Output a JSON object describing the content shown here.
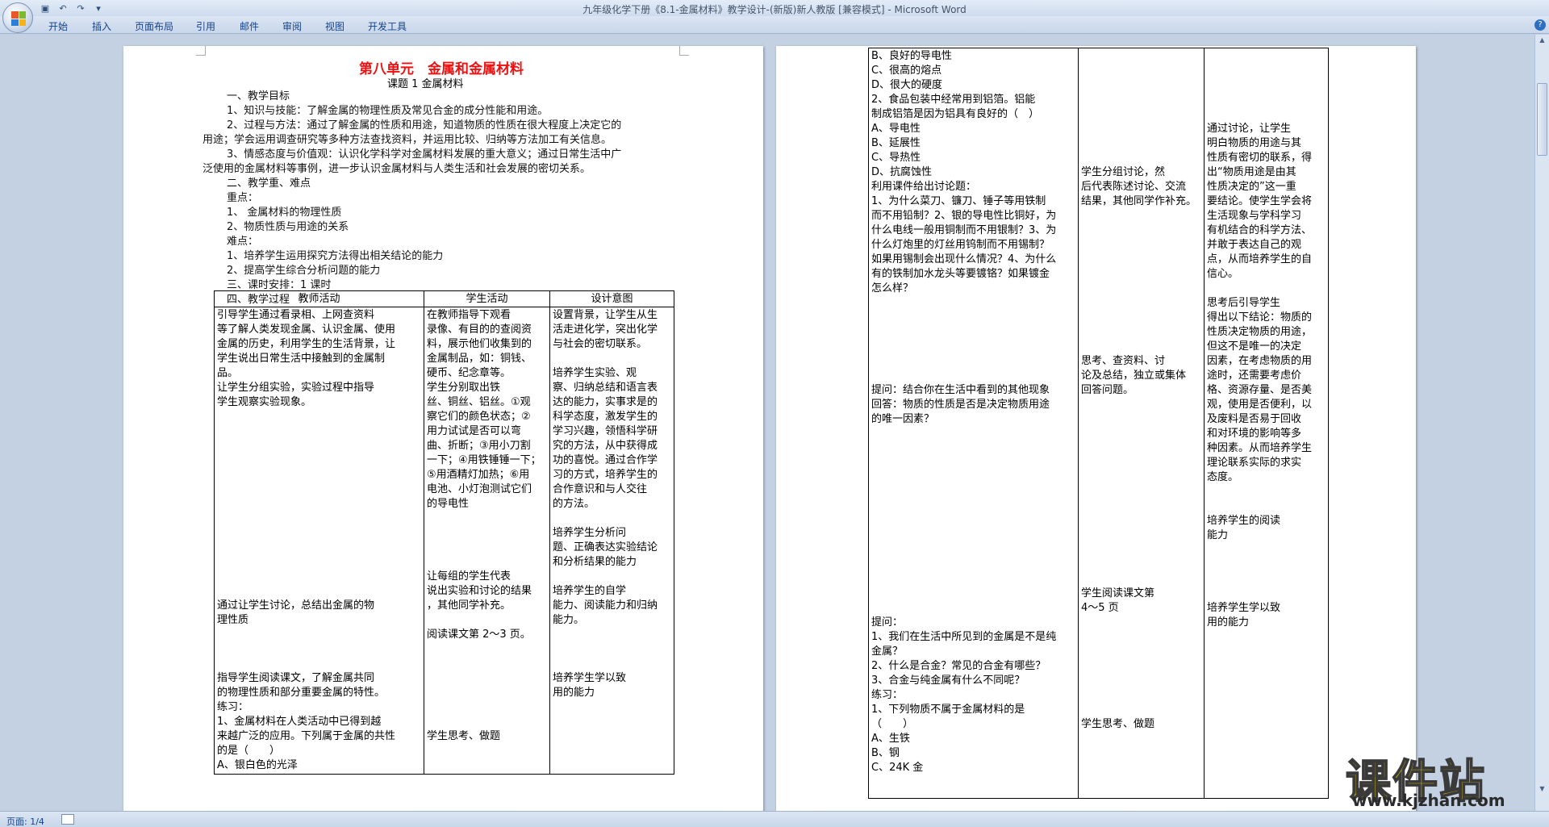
{
  "window": {
    "title": "九年级化学下册《8.1-金属材料》教学设计-(新版)新人教版 [兼容模式] - Microsoft Word",
    "ribbon_tabs": [
      "开始",
      "插入",
      "页面布局",
      "引用",
      "邮件",
      "审阅",
      "视图",
      "开发工具"
    ],
    "qat_icons": [
      "save-icon",
      "undo-icon",
      "redo-icon",
      "customize-icon"
    ],
    "help_label": "?"
  },
  "status": {
    "page": "页面: 1/4"
  },
  "watermark": {
    "text": "课件站",
    "url": "www.kjzhan.com"
  },
  "page1": {
    "title": "第八单元　金属和金属材料",
    "subtitle": "课题 1 金属材料",
    "lines": [
      "一、教学目标",
      "1、知识与技能：了解金属的物理性质及常见合金的成分性能和用途。",
      "2、过程与方法：通过了解金属的性质和用途，知道物质的性质在很大程度上决定它的",
      "用途；学会运用调查研究等多种方法查找资料，并运用比较、归纳等方法加工有关信息。",
      "3、情感态度与价值观：认识化学科学对金属材料发展的重大意义；通过日常生活中广",
      "泛使用的金属材料等事例，进一步认识金属材料与人类生活和社会发展的密切关系。",
      "二、教学重、难点",
      "重点：",
      "1、 金属材料的物理性质",
      "2、物质性质与用途的关系",
      "难点：",
      "1、培养学生运用探究方法得出相关结论的能力",
      "2、提高学生综合分析问题的能力",
      "三、课时安排：1 课时",
      "四、教学过程"
    ],
    "table_headers": [
      "教师活动",
      "学生活动",
      "设计意图"
    ],
    "col1": [
      "引导学生通过看录相、上网查资料",
      "等了解人类发现金属、认识金属、使用",
      "金属的历史，利用学生的生活背景，让",
      "学生说出日常生活中接触到的金属制",
      "品。",
      "让学生分组实验，实验过程中指导",
      "学生观察实验现象。",
      "",
      "",
      "",
      "",
      "",
      "",
      "",
      "",
      "",
      "",
      "",
      "",
      "",
      "通过让学生讨论，总结出金属的物",
      "理性质",
      "",
      "",
      "",
      "指导学生阅读课文，了解金属共同",
      "的物理性质和部分重要金属的特性。",
      "练习：",
      "1、金属材料在人类活动中已得到越",
      "来越广泛的应用。下列属于金属的共性",
      "的是（　　）",
      "A、银白色的光泽"
    ],
    "col2": [
      "在教师指导下观看",
      "录像、有目的的查阅资",
      "料，展示他们收集到的",
      "金属制品，如：铜钱、",
      "硬币、纪念章等。",
      "学生分别取出铁",
      "丝、铜丝、铝丝。①观",
      "察它们的颜色状态；②",
      "用力试试是否可以弯",
      "曲、折断；③用小刀割",
      "一下；④用铁锤锤一下；",
      "⑤用酒精灯加热；⑥用",
      "电池、小灯泡测试它们",
      "的导电性",
      "",
      "",
      "",
      "",
      "让每组的学生代表",
      "说出实验和讨论的结果",
      "，其他同学补充。",
      "",
      "阅读课文第 2～3 页。",
      "",
      "",
      "",
      "",
      "",
      "",
      "学生思考、做题"
    ],
    "col3": [
      "设置背景，让学生从生",
      "活走进化学，突出化学",
      "与社会的密切联系。",
      "",
      "培养学生实验、观",
      "察、归纳总结和语言表",
      "达的能力，实事求是的",
      "科学态度，激发学生的",
      "学习兴趣，领悟科学研",
      "究的方法，从中获得成",
      "功的喜悦。通过合作学",
      "习的方式，培养学生的",
      "合作意识和与人交往",
      "的方法。",
      "",
      "培养学生分析问",
      "题、正确表达实验结论",
      "和分析结果的能力",
      "",
      "培养学生的自学",
      "能力、阅读能力和归纳",
      "能力。",
      "",
      "",
      "",
      "培养学生学以致",
      "用的能力",
      "",
      "",
      "",
      ""
    ]
  },
  "page2": {
    "col1": [
      "B、良好的导电性",
      "C、很高的熔点",
      "D、很大的硬度",
      "2、食品包装中经常用到铝箔。铝能",
      "制成铝箔是因为铝具有良好的（　）",
      "A、导电性",
      "B、延展性",
      "C、导热性",
      "D、抗腐蚀性",
      "利用课件给出讨论题：",
      "1、为什么菜刀、镰刀、锤子等用铁制",
      "而不用铅制？2、银的导电性比铜好，为",
      "什么电线一般用铜制而不用银制？3、为",
      "什么灯炮里的灯丝用钨制而不用锡制？",
      "如果用锡制会出现什么情况？4、为什么",
      "有的铁制加水龙头等要镀铬？如果镀金",
      "怎么样？",
      "",
      "",
      "",
      "",
      "",
      "",
      "提问：结合你在生活中看到的其他现象",
      "回答：物质的性质是否是决定物质用途",
      "的唯一因素？",
      "",
      "",
      "",
      "",
      "",
      "",
      "",
      "",
      "",
      "",
      "",
      "",
      "",
      "提问：",
      "1、我们在生活中所见到的金属是不是纯",
      "金属？",
      "2、什么是合金？常见的合金有哪些？",
      "3、合金与纯金属有什么不同呢？",
      "练习：",
      "1、下列物质不属于金属材料的是",
      "（　　）",
      "A、生铁",
      "B、钢",
      "C、24K 金"
    ],
    "col2": [
      "",
      "",
      "",
      "",
      "",
      "",
      "",
      "",
      "学生分组讨论，然",
      "后代表陈述讨论、交流",
      "结果，其他同学作补充。",
      "",
      "",
      "",
      "",
      "",
      "",
      "",
      "",
      "",
      "",
      "思考、查资料、讨",
      "论及总结，独立或集体",
      "回答问题。",
      "",
      "",
      "",
      "",
      "",
      "",
      "",
      "",
      "",
      "",
      "",
      "",
      "",
      "学生阅读课文第",
      "4～5 页",
      "",
      "",
      "",
      "",
      "",
      "",
      "",
      "学生思考、做题"
    ],
    "col3": [
      "",
      "",
      "",
      "",
      "",
      "通过讨论，让学生",
      "明白物质的用途与其",
      "性质有密切的联系，得",
      "出“物质用途是由其",
      "性质决定的”这一重",
      "要结论。使学生学会将",
      "生活现象与学科学习",
      "有机结合的科学方法、",
      "并敢于表达自己的观",
      "点，从而培养学生的自",
      "信心。",
      "",
      "思考后引导学生",
      "得出以下结论：物质的",
      "性质决定物质的用途，",
      "但这不是唯一的决定",
      "因素，在考虑物质的用",
      "途时，还需要考虑价",
      "格、资源存量、是否美",
      "观，使用是否便利，以",
      "及废料是否易于回收",
      "和对环境的影响等多",
      "种因素。从而培养学生",
      "理论联系实际的求实",
      "态度。",
      "",
      "",
      "培养学生的阅读",
      "能力",
      "",
      "",
      "",
      "",
      "培养学生学以致",
      "用的能力",
      "",
      "",
      "",
      "",
      "",
      "",
      "",
      ""
    ]
  }
}
